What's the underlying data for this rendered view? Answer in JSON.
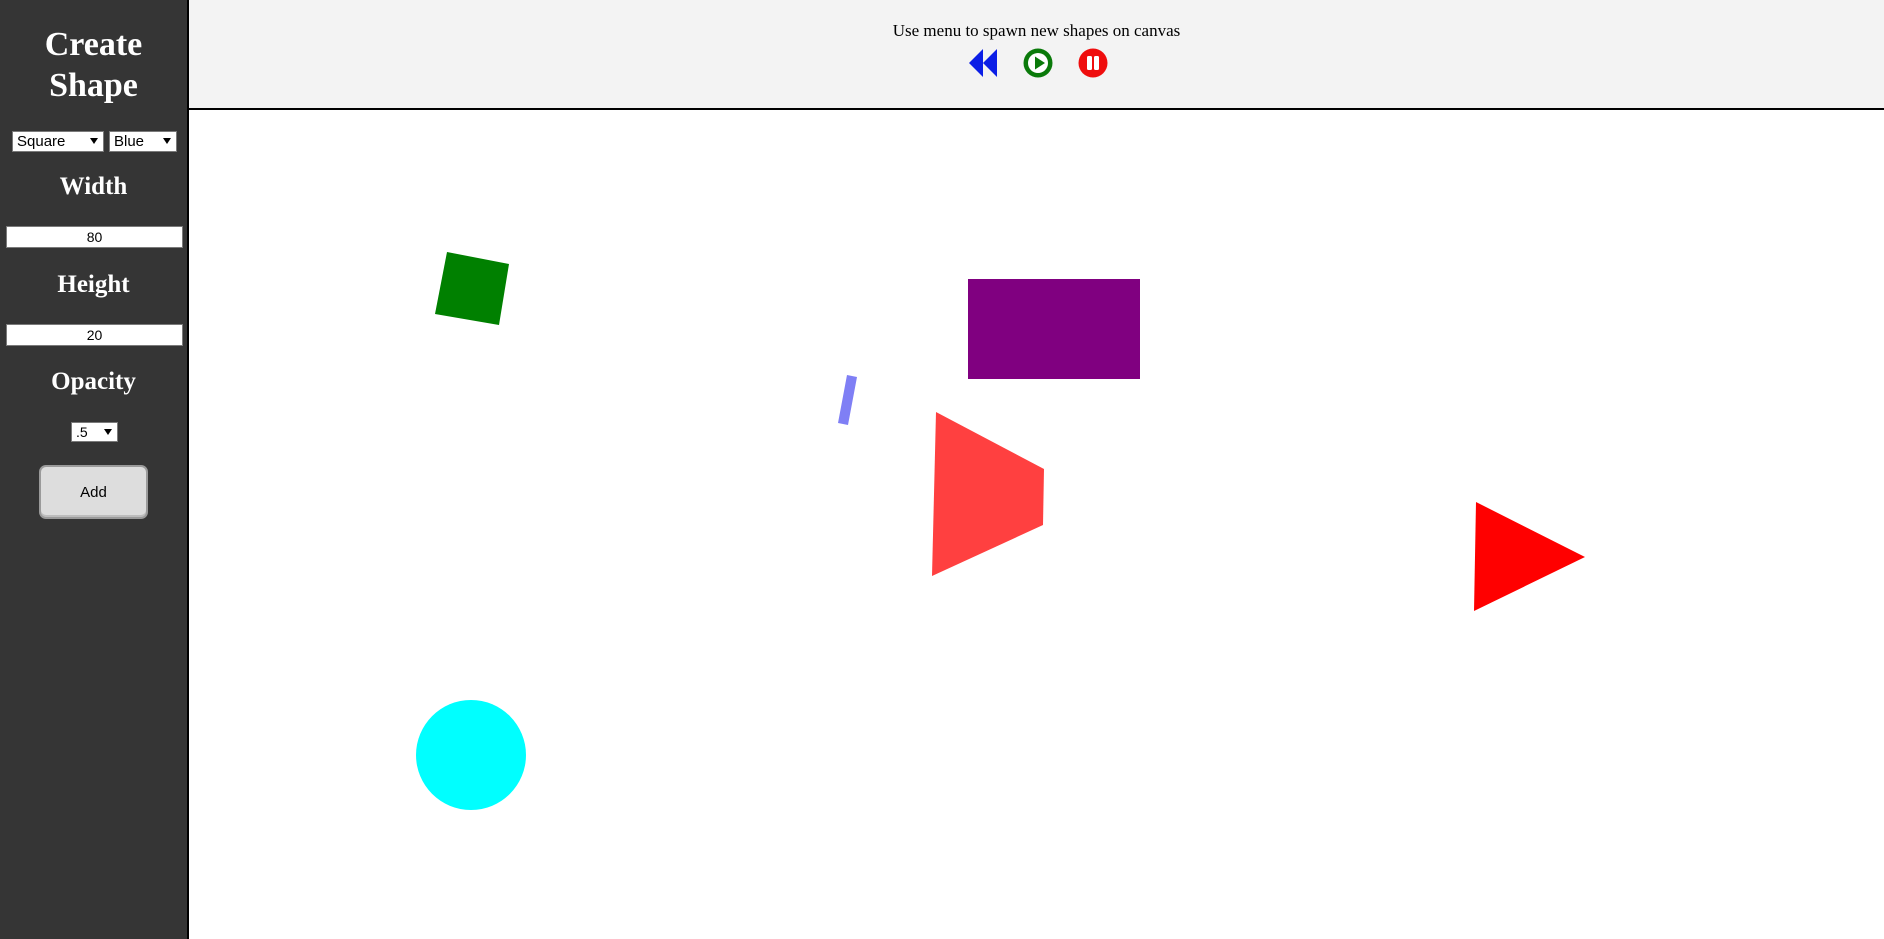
{
  "sidebar": {
    "title": "Create Shape",
    "shape_select": {
      "value": "Square"
    },
    "color_select": {
      "value": "Blue"
    },
    "width_label": "Width",
    "width_value": "80",
    "height_label": "Height",
    "height_value": "20",
    "opacity_label": "Opacity",
    "opacity_select": {
      "value": ".5"
    },
    "add_label": "Add"
  },
  "header": {
    "instructions": "Use menu to spawn new shapes on canvas",
    "controls": [
      {
        "name": "rewind",
        "icon": "rewind-icon",
        "color": "#0b1ee6"
      },
      {
        "name": "play",
        "icon": "play-icon",
        "color": "#0a7a0a"
      },
      {
        "name": "pause",
        "icon": "pause-icon",
        "color": "#ef0d0d"
      }
    ]
  },
  "colors": {
    "sidebar_bg": "#353535",
    "topbar_bg": "#f3f3f3",
    "green_square": "#008000",
    "blue_rect": "#7f7ff5",
    "purple_rect": "#800080",
    "faded_red_triangle": "#ff4040",
    "red_triangle": "#ff0000",
    "cyan_circle": "#00ffff"
  }
}
